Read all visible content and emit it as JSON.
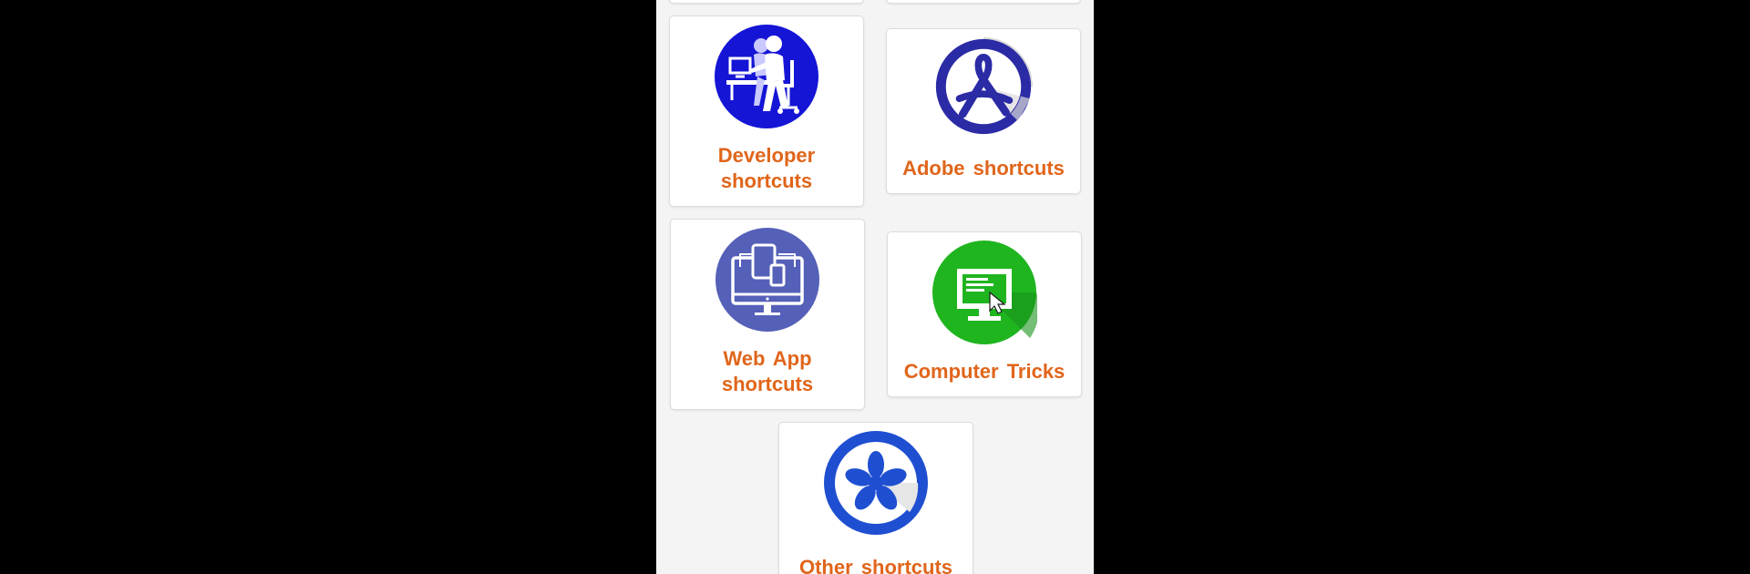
{
  "menu": {
    "items": [
      {
        "id": "developer",
        "label": "Developer\nshortcuts",
        "icon": "developer-workstation-icon",
        "color": "#1515d6"
      },
      {
        "id": "adobe",
        "label": "Adobe  shortcuts",
        "icon": "adobe-acrobat-icon",
        "color": "#2b2ba6"
      },
      {
        "id": "webapp",
        "label": "Web  App\nshortcuts",
        "icon": "responsive-devices-icon",
        "color": "#5560b8"
      },
      {
        "id": "computer",
        "label": "Computer  Tricks",
        "icon": "computer-monitor-icon",
        "color": "#1fb51f"
      },
      {
        "id": "other",
        "label": "Other  shortcuts",
        "icon": "asterisk-flower-icon",
        "color": "#1f4fd1"
      }
    ]
  },
  "colors": {
    "label": "#e0651a",
    "background": "#f4f4f4",
    "card": "#ffffff"
  }
}
